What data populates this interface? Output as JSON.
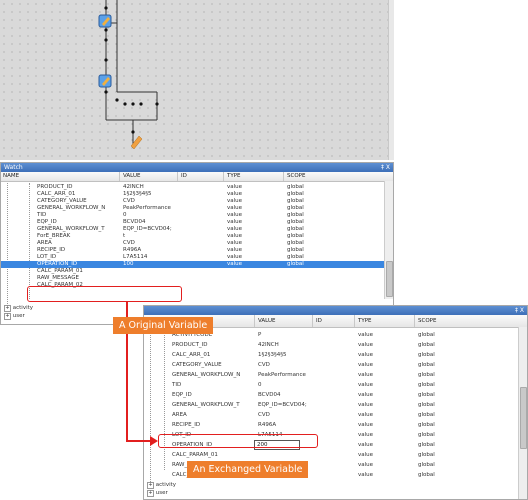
{
  "watch1": {
    "title": "Watch",
    "controls": "‡ X",
    "columns": [
      "NAME",
      "VALUE",
      "ID",
      "TYPE",
      "SCOPE"
    ],
    "rows": [
      {
        "name": "PRODUCT_ID",
        "value": "42INCH",
        "type": "value",
        "scope": "global"
      },
      {
        "name": "CALC_ARR_01",
        "value": "1§2§3§4§5",
        "type": "value",
        "scope": "global"
      },
      {
        "name": "CATEGORY_VALUE",
        "value": "CVD",
        "type": "value",
        "scope": "global"
      },
      {
        "name": "GENERAL_WORKFLOW_N",
        "value": "PeakPerformance",
        "type": "value",
        "scope": "global"
      },
      {
        "name": "TID",
        "value": "0",
        "type": "value",
        "scope": "global"
      },
      {
        "name": "EQP_ID",
        "value": "BCVD04",
        "type": "value",
        "scope": "global"
      },
      {
        "name": "GENERAL_WORKFLOW_T",
        "value": "EQP_ID=BCVD04;",
        "type": "value",
        "scope": "global"
      },
      {
        "name": "ForE_BREAK",
        "value": "t",
        "type": "value",
        "scope": "global"
      },
      {
        "name": "AREA",
        "value": "CVD",
        "type": "value",
        "scope": "global"
      },
      {
        "name": "RECIPE_ID",
        "value": "R496A",
        "type": "value",
        "scope": "global"
      },
      {
        "name": "LOT_ID",
        "value": "L7A5114",
        "type": "value",
        "scope": "global"
      },
      {
        "name": "OPERATION_ID",
        "value": "100",
        "type": "value",
        "scope": "global"
      },
      {
        "name": "CALC_PARAM_01",
        "value": "",
        "type": "",
        "scope": ""
      },
      {
        "name": "RAW_MESSAGE",
        "value": "",
        "type": "",
        "scope": ""
      },
      {
        "name": "CALC_PARAM_02",
        "value": "",
        "type": "",
        "scope": ""
      }
    ],
    "groups": [
      "activity",
      "user"
    ]
  },
  "watch2": {
    "controls": "‡ X",
    "columns": [
      "VALUE",
      "ID",
      "TYPE",
      "SCOPE"
    ],
    "rows": [
      {
        "name": "ACTIVITYCODE",
        "value": "P",
        "type": "value",
        "scope": "global"
      },
      {
        "name": "PRODUCT_ID",
        "value": "42INCH",
        "type": "value",
        "scope": "global"
      },
      {
        "name": "CALC_ARR_01",
        "value": "1§2§3§4§5",
        "type": "value",
        "scope": "global"
      },
      {
        "name": "CATEGORY_VALUE",
        "value": "CVD",
        "type": "value",
        "scope": "global"
      },
      {
        "name": "GENERAL_WORKFLOW_N",
        "value": "PeakPerformance",
        "type": "value",
        "scope": "global"
      },
      {
        "name": "TID",
        "value": "0",
        "type": "value",
        "scope": "global"
      },
      {
        "name": "EQP_ID",
        "value": "BCVD04",
        "type": "value",
        "scope": "global"
      },
      {
        "name": "GENERAL_WORKFLOW_T",
        "value": "EQP_ID=BCVD04;",
        "type": "value",
        "scope": "global"
      },
      {
        "name": "AREA",
        "value": "CVD",
        "type": "value",
        "scope": "global"
      },
      {
        "name": "RECIPE_ID",
        "value": "R496A",
        "type": "value",
        "scope": "global"
      },
      {
        "name": "LOT_ID",
        "value": "L7A5114",
        "type": "value",
        "scope": "global"
      },
      {
        "name": "OPERATION_ID",
        "value": "200",
        "type": "value",
        "scope": "global"
      },
      {
        "name": "CALC_PARAM_01",
        "value": "",
        "type": "value",
        "scope": "global"
      },
      {
        "name": "RAW_MESSAGE",
        "value": "",
        "type": "value",
        "scope": "global"
      },
      {
        "name": "CALC_PARAM_02",
        "value": "",
        "type": "value",
        "scope": "global"
      }
    ],
    "groups": [
      "activity",
      "user"
    ]
  },
  "callouts": {
    "original": "A Original Variable",
    "exchanged": "An Exchanged Variable"
  },
  "colors": {
    "accent_orange": "#ee7e2c",
    "highlight_red": "#e21f1f",
    "selection_blue": "#3a86e0",
    "title_blue": "#4a7cc4"
  }
}
